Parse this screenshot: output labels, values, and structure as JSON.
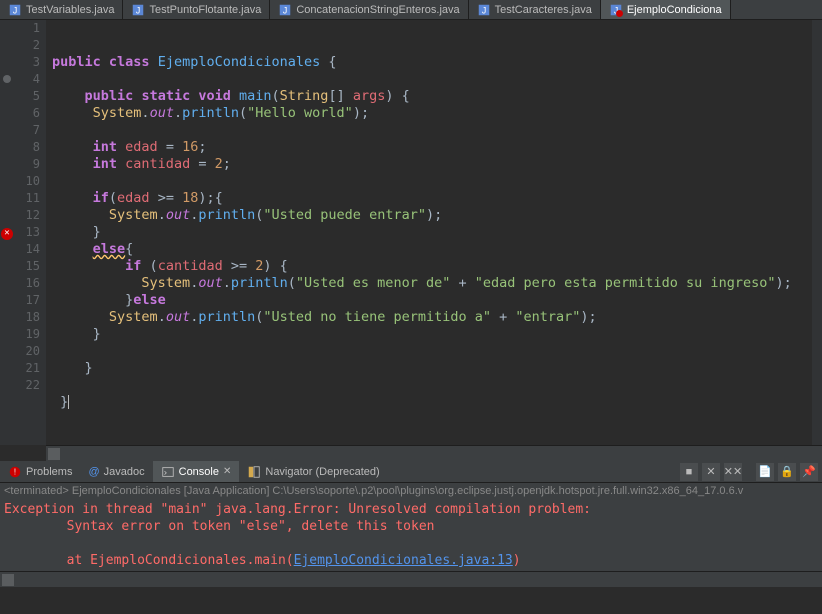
{
  "tabs": [
    {
      "label": "TestVariables.java"
    },
    {
      "label": "TestPuntoFlotante.java"
    },
    {
      "label": "ConcatenacionStringEnteros.java"
    },
    {
      "label": "TestCaracteres.java"
    },
    {
      "label": "EjemploCondiciona"
    }
  ],
  "code": {
    "l2a": "public",
    "l2b": "class",
    "l2c": "EjemploCondicionales",
    "l4a": "public",
    "l4b": "static",
    "l4c": "void",
    "l4d": "main",
    "l4e": "String",
    "l4f": "args",
    "l5a": "System",
    "l5b": "out",
    "l5c": "println",
    "l5d": "\"Hello world\"",
    "l7a": "int",
    "l7b": "edad",
    "l7c": "16",
    "l8a": "int",
    "l8b": "cantidad",
    "l8c": "2",
    "l10a": "if",
    "l10b": "edad",
    "l10c": "18",
    "l11a": "System",
    "l11b": "out",
    "l11c": "println",
    "l11d": "\"Usted puede entrar\"",
    "l13a": "else",
    "l14a": "if",
    "l14b": "cantidad",
    "l14c": "2",
    "l15a": "System",
    "l15b": "out",
    "l15c": "println",
    "l15d": "\"Usted es menor de\"",
    "l15e": "\"edad pero esta permitido su ingreso\"",
    "l16a": "else",
    "l17a": "System",
    "l17b": "out",
    "l17c": "println",
    "l17d": "\"Usted no tiene permitido a\"",
    "l17e": "\"entrar\""
  },
  "panel_tabs": {
    "problems": "Problems",
    "javadoc": "Javadoc",
    "console": "Console",
    "navigator": "Navigator (Deprecated)"
  },
  "term_header": "<terminated> EjemploCondicionales [Java Application] C:\\Users\\soporte\\.p2\\pool\\plugins\\org.eclipse.justj.openjdk.hotspot.jre.full.win32.x86_64_17.0.6.v",
  "console": {
    "l1": "Exception in thread \"main\" java.lang.Error: Unresolved compilation problem: ",
    "l2": "\tSyntax error on token \"else\", delete this token",
    "l3": "\tat EjemploCondicionales.main(",
    "l3link": "EjemploCondicionales.java:13",
    "l3end": ")"
  },
  "lines": [
    "1",
    "2",
    "3",
    "4",
    "5",
    "6",
    "7",
    "8",
    "9",
    "10",
    "11",
    "12",
    "13",
    "14",
    "15",
    "16",
    "17",
    "18",
    "19",
    "20",
    "21",
    "22"
  ]
}
